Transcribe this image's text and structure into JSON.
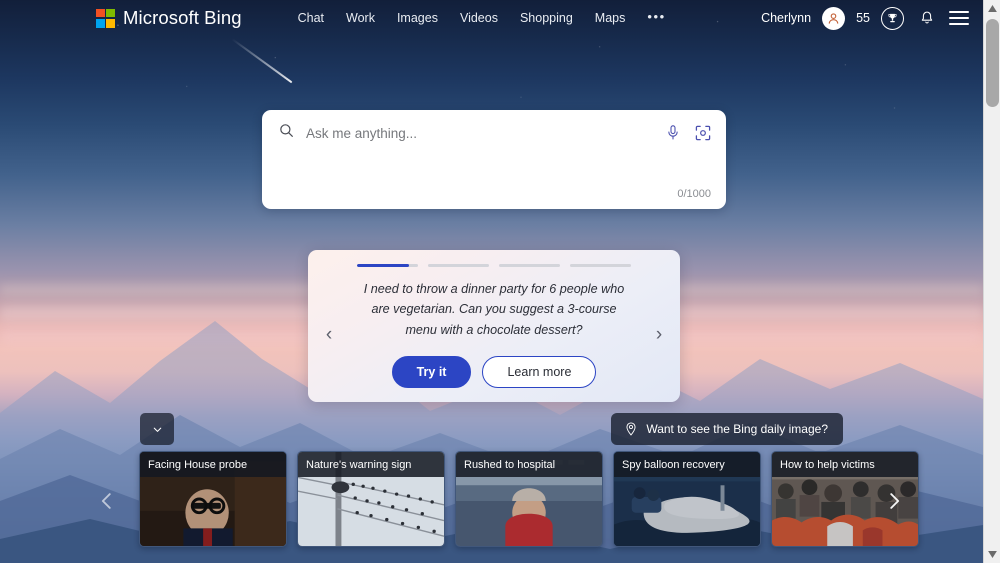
{
  "header": {
    "brand": "Microsoft Bing",
    "logo_colors": {
      "top_left": "#f25022",
      "top_right": "#7fba00",
      "bottom_left": "#00a4ef",
      "bottom_right": "#ffb900"
    },
    "nav": [
      {
        "label": "Chat",
        "name": "nav-chat"
      },
      {
        "label": "Work",
        "name": "nav-work"
      },
      {
        "label": "Images",
        "name": "nav-images"
      },
      {
        "label": "Videos",
        "name": "nav-videos"
      },
      {
        "label": "Shopping",
        "name": "nav-shopping"
      },
      {
        "label": "Maps",
        "name": "nav-maps"
      }
    ],
    "more_label": "•••",
    "username": "Cherlynn",
    "avatar_icon": "person-icon",
    "points": "55",
    "rewards_icon": "trophy-icon",
    "notifications_icon": "bell-icon",
    "menu_icon": "hamburger-icon"
  },
  "search": {
    "placeholder": "Ask me anything...",
    "value": "",
    "char_count": "0/1000",
    "search_icon": "search-icon",
    "mic_icon": "microphone-icon",
    "lens_icon": "visual-search-icon"
  },
  "suggestion": {
    "progress": [
      85,
      0,
      0,
      0
    ],
    "text": "I need to throw a dinner party for 6 people who are vegetarian. Can you suggest a 3-course menu with a chocolate dessert?",
    "prev_icon": "chevron-left-icon",
    "next_icon": "chevron-right-icon",
    "try_label": "Try it",
    "learn_label": "Learn more",
    "accent_color": "#2c45c4"
  },
  "daily_image": {
    "label": "Want to see the Bing daily image?",
    "icon": "location-pin-icon"
  },
  "collapse": {
    "icon": "chevron-down-icon"
  },
  "carousel": {
    "prev_icon": "chevron-left-icon",
    "next_icon": "chevron-right-icon",
    "cards": [
      {
        "title": "Facing House probe"
      },
      {
        "title": "Nature's warning sign"
      },
      {
        "title": "Rushed to hospital"
      },
      {
        "title": "Spy balloon recovery"
      },
      {
        "title": "How to help victims"
      }
    ]
  },
  "scrollbar": {
    "up_icon": "triangle-up-icon",
    "down_icon": "triangle-down-icon"
  }
}
